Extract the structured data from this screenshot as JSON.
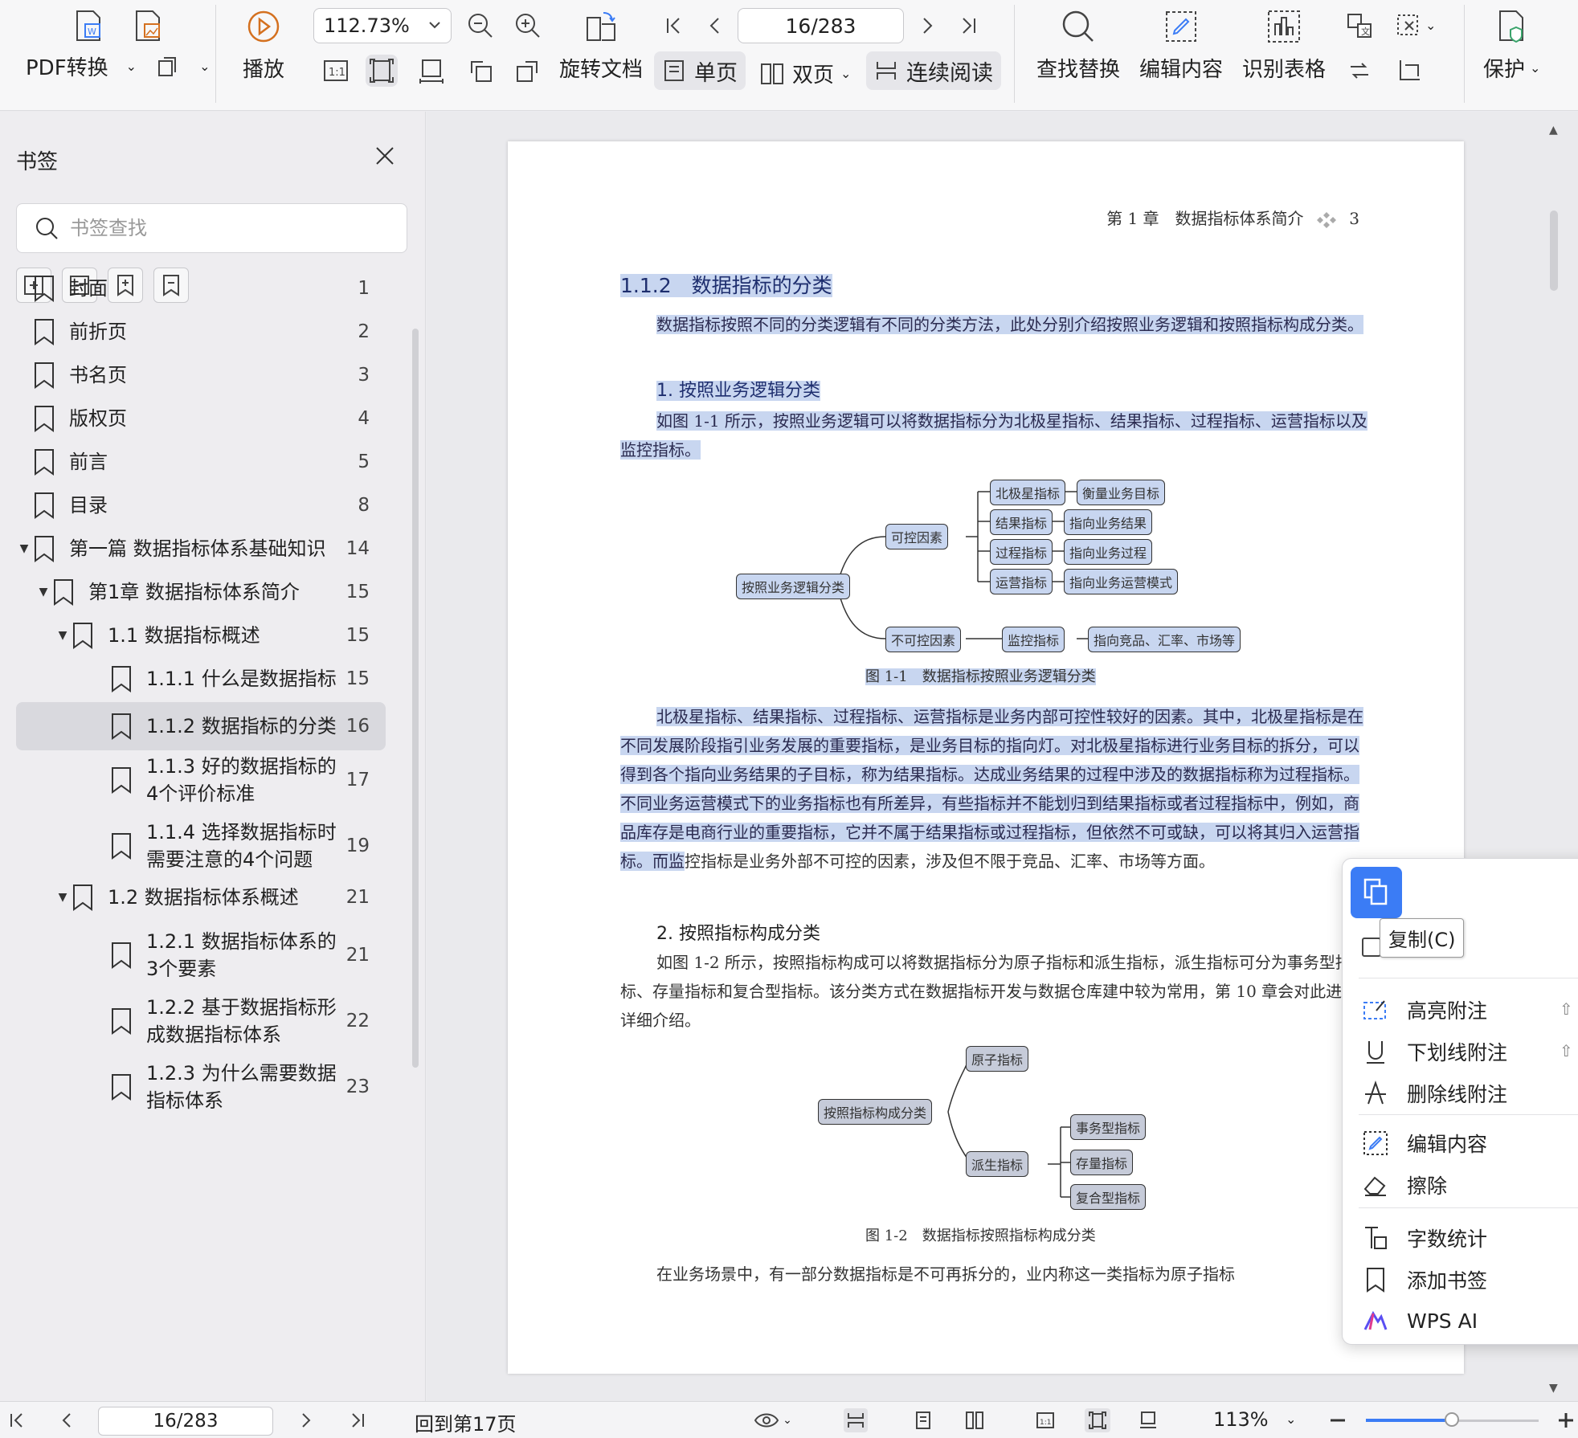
{
  "toolbar": {
    "pdf_convert": "PDF转换",
    "play": "播放",
    "zoom": "112.73%",
    "rotate": "旋转文档",
    "page": "16/283",
    "single": "单页",
    "double": "双页",
    "continuous": "连续阅读",
    "find_replace": "查找替换",
    "edit_content": "编辑内容",
    "recognize_table": "识别表格",
    "protect": "保护",
    "actual_size": "1:1"
  },
  "sidebar": {
    "title": "书签",
    "search_placeholder": "书签查找",
    "items": [
      {
        "label": "封面",
        "page": "1"
      },
      {
        "label": "前折页",
        "page": "2"
      },
      {
        "label": "书名页",
        "page": "3"
      },
      {
        "label": "版权页",
        "page": "4"
      },
      {
        "label": "前言",
        "page": "5"
      },
      {
        "label": "目录",
        "page": "8"
      },
      {
        "label": "第一篇 数据指标体系基础知识",
        "page": "14"
      },
      {
        "label": "第1章 数据指标体系简介",
        "page": "15"
      },
      {
        "label": "1.1 数据指标概述",
        "page": "15"
      },
      {
        "label": "1.1.1 什么是数据指标",
        "page": "15"
      },
      {
        "label": "1.1.2 数据指标的分类",
        "page": "16"
      },
      {
        "label": "1.1.3 好的数据指标的4个评价标准",
        "page": "17"
      },
      {
        "label": "1.1.4 选择数据指标时需要注意的4个问题",
        "page": "19"
      },
      {
        "label": "1.2 数据指标体系概述",
        "page": "21"
      },
      {
        "label": "1.2.1 数据指标体系的3个要素",
        "page": "21"
      },
      {
        "label": "1.2.2 基于数据指标形成数据指标体系",
        "page": "22"
      },
      {
        "label": "1.2.3 为什么需要数据指标体系",
        "page": "23"
      }
    ]
  },
  "document": {
    "header_chapter": "第 1 章　数据指标体系简介",
    "header_page": "3",
    "section_title": "1.1.2　数据指标的分类",
    "para1": "数据指标按照不同的分类逻辑有不同的分类方法，此处分别介绍按照业务逻辑和按照指标构成分类。",
    "sub1": "1. 按照业务逻辑分类",
    "para2": "如图 1-1 所示，按照业务逻辑可以将数据指标分为北极星指标、结果指标、过程指标、运营指标以及监控指标。",
    "fig1": {
      "root": "按照业务逻辑分类",
      "controllable": "可控因素",
      "uncontrollable": "不可控因素",
      "n1": "北极星指标",
      "d1": "衡量业务目标",
      "n2": "结果指标",
      "d2": "指向业务结果",
      "n3": "过程指标",
      "d3": "指向业务过程",
      "n4": "运营指标",
      "d4": "指向业务运营模式",
      "n5": "监控指标",
      "d5": "指向竞品、汇率、市场等",
      "caption": "图 1-1　数据指标按照业务逻辑分类"
    },
    "para3": "北极星指标、结果指标、过程指标、运营指标是业务内部可控性较好的因素。其中，北极星指标是在不同发展阶段指引业务发展的重要指标，是业务目标的指向灯。对北极星指标进行业务目标的拆分，可以得到各个指向业务结果的子目标，称为结果指标。达成业务结果的过程中涉及的数据指标称为过程指标。不同业务运营模式下的业务指标也有所差异，有些指标并不能划归到结果指标或者过程指标中，例如，商品库存是电商行业的重要指标，它并不属于结果指标或过程指标，但依然不可或缺，可以将其归入运营指标。而监",
    "para3b": "控指标是业务外部不可控的因素，涉及但不限于竞品、汇率、市场等方面。",
    "sub2": "2. 按照指标构成分类",
    "para4": "如图 1-2 所示，按照指标构成可以将数据指标分为原子指标和派生指标，派生指标可分为事务型指标、存量指标和复合型指标。该分类方式在数据指标开发与数据仓库建中较为常用，第 10 章会对此进行详细介绍。",
    "fig2": {
      "root": "按照指标构成分类",
      "atomic": "原子指标",
      "derived": "派生指标",
      "t1": "事务型指标",
      "t2": "存量指标",
      "t3": "复合型指标",
      "caption": "图 1-2　数据指标按照指标构成分类"
    },
    "para5": "在业务场景中，有一部分数据指标是不可再拆分的，业内称这一类指标为原子指标"
  },
  "context_menu": {
    "copy_tip": "复制(C)",
    "items": [
      "高亮附注",
      "下划线附注",
      "删除线附注",
      "编辑内容",
      "擦除",
      "字数统计",
      "添加书签",
      "WPS AI"
    ]
  },
  "statusbar": {
    "page": "16/283",
    "back_to": "回到第17页",
    "zoom": "113%"
  },
  "colors": {
    "accent": "#3b7cf5",
    "highlight": "#c8d6f0"
  }
}
